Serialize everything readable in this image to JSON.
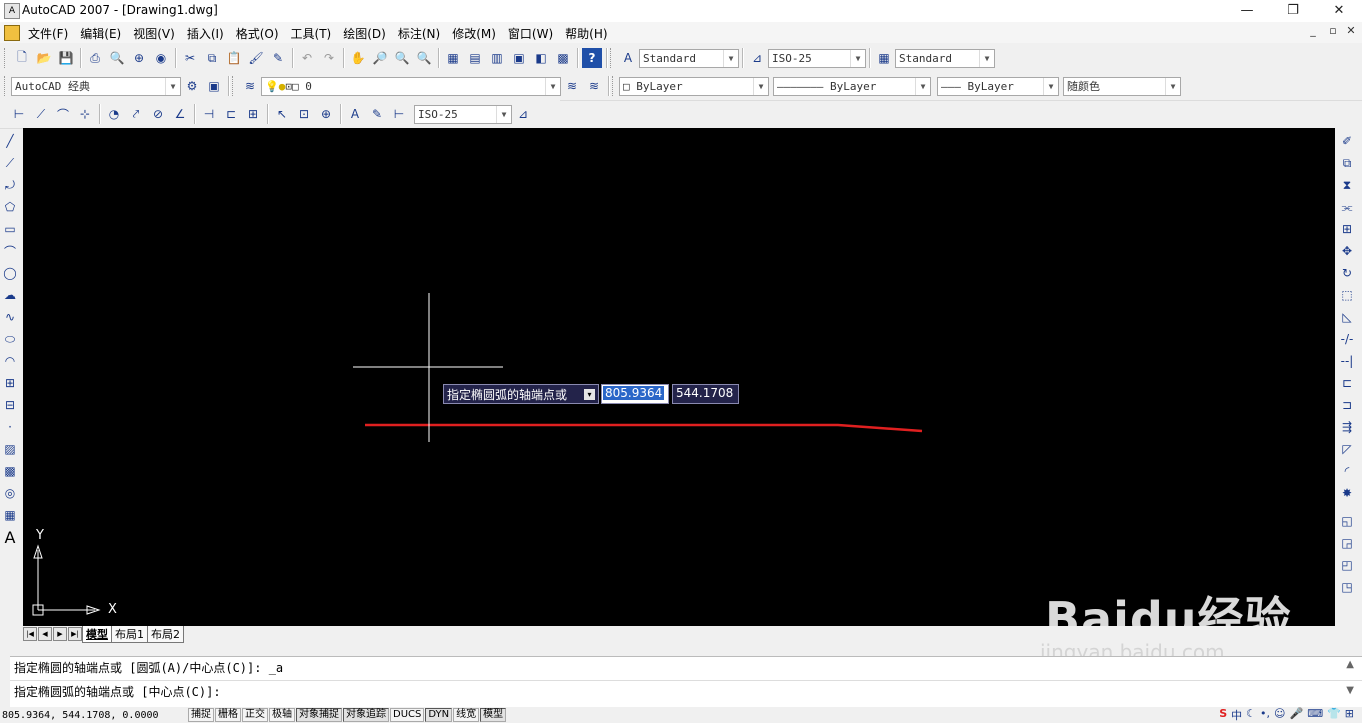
{
  "window": {
    "title": "AutoCAD 2007 - [Drawing1.dwg]",
    "icon_name": "autocad-app-icon",
    "minimize": "—",
    "maximize": "❐",
    "close": "✕"
  },
  "menubar": {
    "items": [
      "文件(F)",
      "编辑(E)",
      "视图(V)",
      "插入(I)",
      "格式(O)",
      "工具(T)",
      "绘图(D)",
      "标注(N)",
      "修改(M)",
      "窗口(W)",
      "帮助(H)"
    ],
    "mdi": [
      "_",
      "▫",
      "✕"
    ]
  },
  "toolbar_standard": {
    "text_style": "Standard",
    "dim_style": "ISO-25",
    "table_style": "Standard"
  },
  "toolbar_workspace": {
    "workspace": "AutoCAD 经典",
    "layer": "0",
    "color": "ByLayer",
    "linetype": "ByLayer",
    "lineweight": "ByLayer",
    "plotstyle": "随颜色"
  },
  "toolbar_dimension": {
    "dim_style": "ISO-25"
  },
  "canvas": {
    "background": "#000000",
    "dynamic_input": {
      "prompt": "指定椭圆弧的轴端点或",
      "x_value": "805.9364",
      "y_value": "544.1708"
    },
    "ucs": {
      "x_label": "X",
      "y_label": "Y"
    },
    "line_color": "#e02020"
  },
  "tabs": {
    "items": [
      "模型",
      "布局1",
      "布局2"
    ],
    "active": "模型"
  },
  "command": {
    "history": "指定椭圆的轴端点或 [圆弧(A)/中心点(C)]: _a",
    "current": "指定椭圆弧的轴端点或 [中心点(C)]:"
  },
  "status": {
    "coords": "805.9364,  544.1708,  0.0000",
    "toggles": [
      "捕捉",
      "栅格",
      "正交",
      "极轴",
      "对象捕捉",
      "对象追踪",
      "DUCS",
      "DYN",
      "线宽",
      "模型"
    ]
  },
  "watermark": {
    "brand": "Baidu经验",
    "url": "jingyan.baidu.com"
  }
}
